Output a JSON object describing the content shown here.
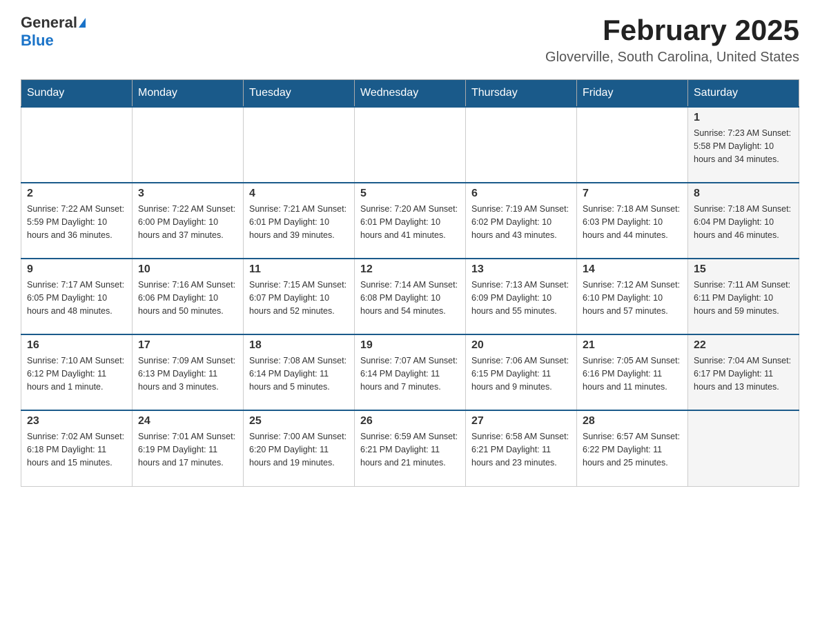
{
  "header": {
    "logo_general": "General",
    "logo_blue": "Blue",
    "main_title": "February 2025",
    "subtitle": "Gloverville, South Carolina, United States"
  },
  "weekdays": [
    "Sunday",
    "Monday",
    "Tuesday",
    "Wednesday",
    "Thursday",
    "Friday",
    "Saturday"
  ],
  "weeks": [
    [
      {
        "day": "",
        "info": ""
      },
      {
        "day": "",
        "info": ""
      },
      {
        "day": "",
        "info": ""
      },
      {
        "day": "",
        "info": ""
      },
      {
        "day": "",
        "info": ""
      },
      {
        "day": "",
        "info": ""
      },
      {
        "day": "1",
        "info": "Sunrise: 7:23 AM\nSunset: 5:58 PM\nDaylight: 10 hours and 34 minutes.",
        "shaded": true
      }
    ],
    [
      {
        "day": "2",
        "info": "Sunrise: 7:22 AM\nSunset: 5:59 PM\nDaylight: 10 hours and 36 minutes."
      },
      {
        "day": "3",
        "info": "Sunrise: 7:22 AM\nSunset: 6:00 PM\nDaylight: 10 hours and 37 minutes."
      },
      {
        "day": "4",
        "info": "Sunrise: 7:21 AM\nSunset: 6:01 PM\nDaylight: 10 hours and 39 minutes."
      },
      {
        "day": "5",
        "info": "Sunrise: 7:20 AM\nSunset: 6:01 PM\nDaylight: 10 hours and 41 minutes."
      },
      {
        "day": "6",
        "info": "Sunrise: 7:19 AM\nSunset: 6:02 PM\nDaylight: 10 hours and 43 minutes."
      },
      {
        "day": "7",
        "info": "Sunrise: 7:18 AM\nSunset: 6:03 PM\nDaylight: 10 hours and 44 minutes."
      },
      {
        "day": "8",
        "info": "Sunrise: 7:18 AM\nSunset: 6:04 PM\nDaylight: 10 hours and 46 minutes.",
        "shaded": true
      }
    ],
    [
      {
        "day": "9",
        "info": "Sunrise: 7:17 AM\nSunset: 6:05 PM\nDaylight: 10 hours and 48 minutes."
      },
      {
        "day": "10",
        "info": "Sunrise: 7:16 AM\nSunset: 6:06 PM\nDaylight: 10 hours and 50 minutes."
      },
      {
        "day": "11",
        "info": "Sunrise: 7:15 AM\nSunset: 6:07 PM\nDaylight: 10 hours and 52 minutes."
      },
      {
        "day": "12",
        "info": "Sunrise: 7:14 AM\nSunset: 6:08 PM\nDaylight: 10 hours and 54 minutes."
      },
      {
        "day": "13",
        "info": "Sunrise: 7:13 AM\nSunset: 6:09 PM\nDaylight: 10 hours and 55 minutes."
      },
      {
        "day": "14",
        "info": "Sunrise: 7:12 AM\nSunset: 6:10 PM\nDaylight: 10 hours and 57 minutes."
      },
      {
        "day": "15",
        "info": "Sunrise: 7:11 AM\nSunset: 6:11 PM\nDaylight: 10 hours and 59 minutes.",
        "shaded": true
      }
    ],
    [
      {
        "day": "16",
        "info": "Sunrise: 7:10 AM\nSunset: 6:12 PM\nDaylight: 11 hours and 1 minute."
      },
      {
        "day": "17",
        "info": "Sunrise: 7:09 AM\nSunset: 6:13 PM\nDaylight: 11 hours and 3 minutes."
      },
      {
        "day": "18",
        "info": "Sunrise: 7:08 AM\nSunset: 6:14 PM\nDaylight: 11 hours and 5 minutes."
      },
      {
        "day": "19",
        "info": "Sunrise: 7:07 AM\nSunset: 6:14 PM\nDaylight: 11 hours and 7 minutes."
      },
      {
        "day": "20",
        "info": "Sunrise: 7:06 AM\nSunset: 6:15 PM\nDaylight: 11 hours and 9 minutes."
      },
      {
        "day": "21",
        "info": "Sunrise: 7:05 AM\nSunset: 6:16 PM\nDaylight: 11 hours and 11 minutes."
      },
      {
        "day": "22",
        "info": "Sunrise: 7:04 AM\nSunset: 6:17 PM\nDaylight: 11 hours and 13 minutes.",
        "shaded": true
      }
    ],
    [
      {
        "day": "23",
        "info": "Sunrise: 7:02 AM\nSunset: 6:18 PM\nDaylight: 11 hours and 15 minutes."
      },
      {
        "day": "24",
        "info": "Sunrise: 7:01 AM\nSunset: 6:19 PM\nDaylight: 11 hours and 17 minutes."
      },
      {
        "day": "25",
        "info": "Sunrise: 7:00 AM\nSunset: 6:20 PM\nDaylight: 11 hours and 19 minutes."
      },
      {
        "day": "26",
        "info": "Sunrise: 6:59 AM\nSunset: 6:21 PM\nDaylight: 11 hours and 21 minutes."
      },
      {
        "day": "27",
        "info": "Sunrise: 6:58 AM\nSunset: 6:21 PM\nDaylight: 11 hours and 23 minutes."
      },
      {
        "day": "28",
        "info": "Sunrise: 6:57 AM\nSunset: 6:22 PM\nDaylight: 11 hours and 25 minutes."
      },
      {
        "day": "",
        "info": "",
        "shaded": true
      }
    ]
  ]
}
